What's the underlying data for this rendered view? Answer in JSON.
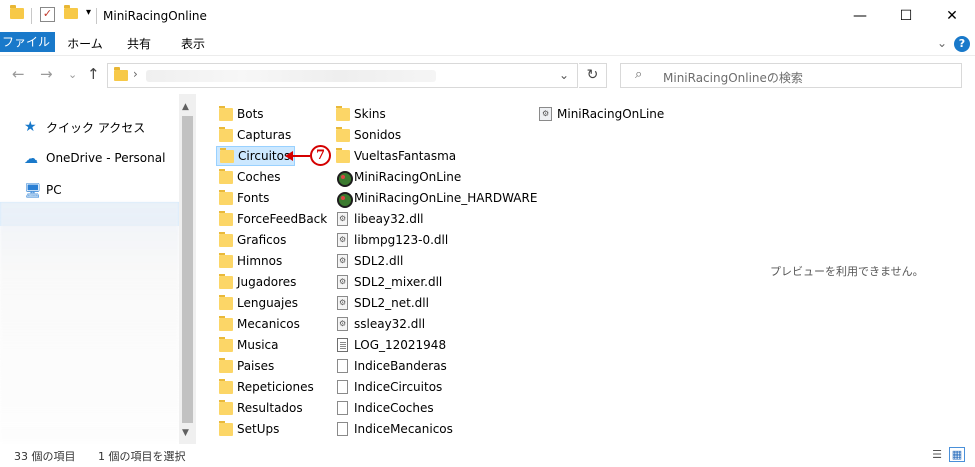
{
  "window": {
    "title": "MiniRacingOnline",
    "minimize": "—",
    "maximize": "☐",
    "close": "✕"
  },
  "ribbon": {
    "tabs": [
      "ファイル",
      "ホーム",
      "共有",
      "表示"
    ],
    "help": "?",
    "chevron": "⌄"
  },
  "address": {
    "back": "←",
    "forward": "→",
    "recent": "⌄",
    "up": "↑",
    "crumb_separator": "›",
    "dropdown": "⌄",
    "refresh": "↻",
    "search_placeholder": "MiniRacingOnlineの検索"
  },
  "navigation": {
    "items": [
      {
        "label": "クイック アクセス",
        "icon": "star-icon"
      },
      {
        "label": "OneDrive - Personal",
        "icon": "cloud-icon"
      },
      {
        "label": "PC",
        "icon": "computer-icon"
      }
    ]
  },
  "files": {
    "column1": [
      {
        "name": "Bots",
        "type": "folder"
      },
      {
        "name": "Capturas",
        "type": "folder"
      },
      {
        "name": "Circuitos",
        "type": "folder",
        "selected": true
      },
      {
        "name": "Coches",
        "type": "folder"
      },
      {
        "name": "Fonts",
        "type": "folder"
      },
      {
        "name": "ForceFeedBack",
        "type": "folder"
      },
      {
        "name": "Graficos",
        "type": "folder"
      },
      {
        "name": "Himnos",
        "type": "folder"
      },
      {
        "name": "Jugadores",
        "type": "folder"
      },
      {
        "name": "Lenguajes",
        "type": "folder"
      },
      {
        "name": "Mecanicos",
        "type": "folder"
      },
      {
        "name": "Musica",
        "type": "folder"
      },
      {
        "name": "Paises",
        "type": "folder"
      },
      {
        "name": "Repeticiones",
        "type": "folder"
      },
      {
        "name": "Resultados",
        "type": "folder"
      },
      {
        "name": "SetUps",
        "type": "folder"
      }
    ],
    "column2": [
      {
        "name": "Skins",
        "type": "folder"
      },
      {
        "name": "Sonidos",
        "type": "folder"
      },
      {
        "name": "VueltasFantasma",
        "type": "folder"
      },
      {
        "name": "MiniRacingOnLine",
        "type": "exe"
      },
      {
        "name": "MiniRacingOnLine_HARDWARE",
        "type": "exe"
      },
      {
        "name": "libeay32.dll",
        "type": "dll"
      },
      {
        "name": "libmpg123-0.dll",
        "type": "dll"
      },
      {
        "name": "SDL2.dll",
        "type": "dll"
      },
      {
        "name": "SDL2_mixer.dll",
        "type": "dll"
      },
      {
        "name": "SDL2_net.dll",
        "type": "dll"
      },
      {
        "name": "ssleay32.dll",
        "type": "dll"
      },
      {
        "name": "LOG_12021948",
        "type": "log"
      },
      {
        "name": "IndiceBanderas",
        "type": "doc"
      },
      {
        "name": "IndiceCircuitos",
        "type": "doc"
      },
      {
        "name": "IndiceCoches",
        "type": "doc"
      },
      {
        "name": "IndiceMecanicos",
        "type": "doc"
      }
    ],
    "column3": [
      {
        "name": "MiniRacingOnLine",
        "type": "cfg"
      }
    ]
  },
  "annotation": {
    "badge": "7",
    "color": "#d40000"
  },
  "preview": {
    "message": "プレビューを利用できません。"
  },
  "status": {
    "count": "33 個の項目",
    "selection": "1 個の項目を選択"
  },
  "colors": {
    "accent": "#1979ca",
    "selection": "#cce8ff",
    "folder": "#fcd667"
  }
}
